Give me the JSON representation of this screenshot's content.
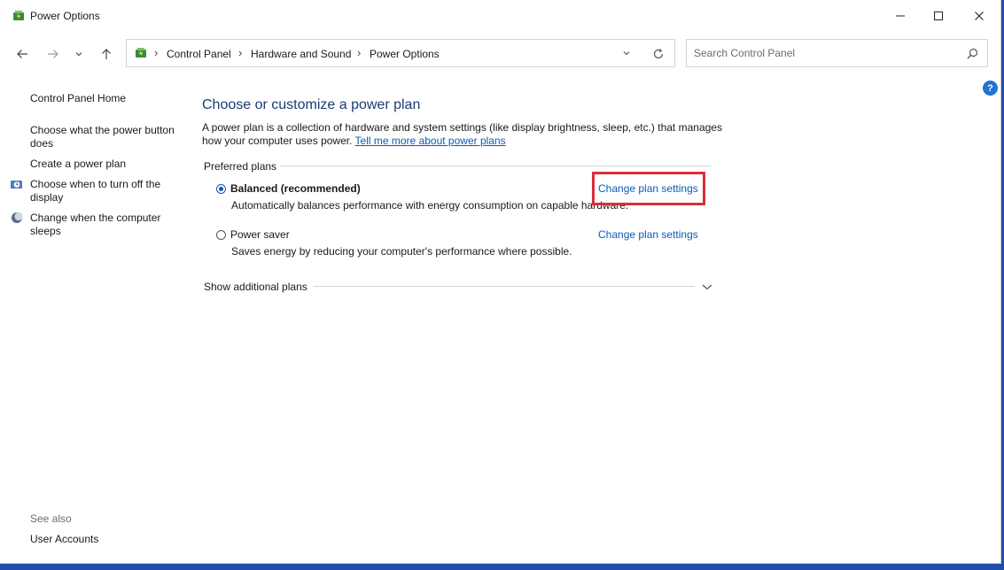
{
  "window": {
    "title": "Power Options",
    "icon": "power-options-icon"
  },
  "titlebar_buttons": [
    "minimize-icon",
    "maximize-icon",
    "close-icon"
  ],
  "nav": {
    "back": "back-arrow-icon",
    "forward": "forward-arrow-icon",
    "recent": "chevron-down-icon",
    "up": "up-arrow-icon"
  },
  "address_bar": {
    "crumbs": [
      "Control Panel",
      "Hardware and Sound",
      "Power Options"
    ],
    "separator": "›"
  },
  "search": {
    "placeholder": "Search Control Panel",
    "value": ""
  },
  "help": "?",
  "sidebar": {
    "home": "Control Panel Home",
    "links": [
      "Choose what the power button does",
      "Create a power plan",
      "Choose when to turn off the display",
      "Change when the computer sleeps"
    ],
    "see_also": "See also",
    "see_also_links": [
      "User Accounts"
    ]
  },
  "main": {
    "title": "Choose or customize a power plan",
    "description": "A power plan is a collection of hardware and system settings (like display brightness, sleep, etc.) that manages how your computer uses power.",
    "learn_more": "Tell me more about power plans",
    "preferred_label": "Preferred plans",
    "plans": [
      {
        "name": "Balanced (recommended)",
        "selected": true,
        "description": "Automatically balances performance with energy consumption on capable hardware.",
        "link": "Change plan settings"
      },
      {
        "name": "Power saver",
        "selected": false,
        "description": "Saves energy by reducing your computer's performance where possible.",
        "link": "Change plan settings"
      }
    ],
    "show_additional": "Show additional plans"
  },
  "colors": {
    "link": "#0a5bb8",
    "heading": "#1c3a75",
    "highlight_box": "#d7303a",
    "radio_selected": "#0b57b8"
  }
}
